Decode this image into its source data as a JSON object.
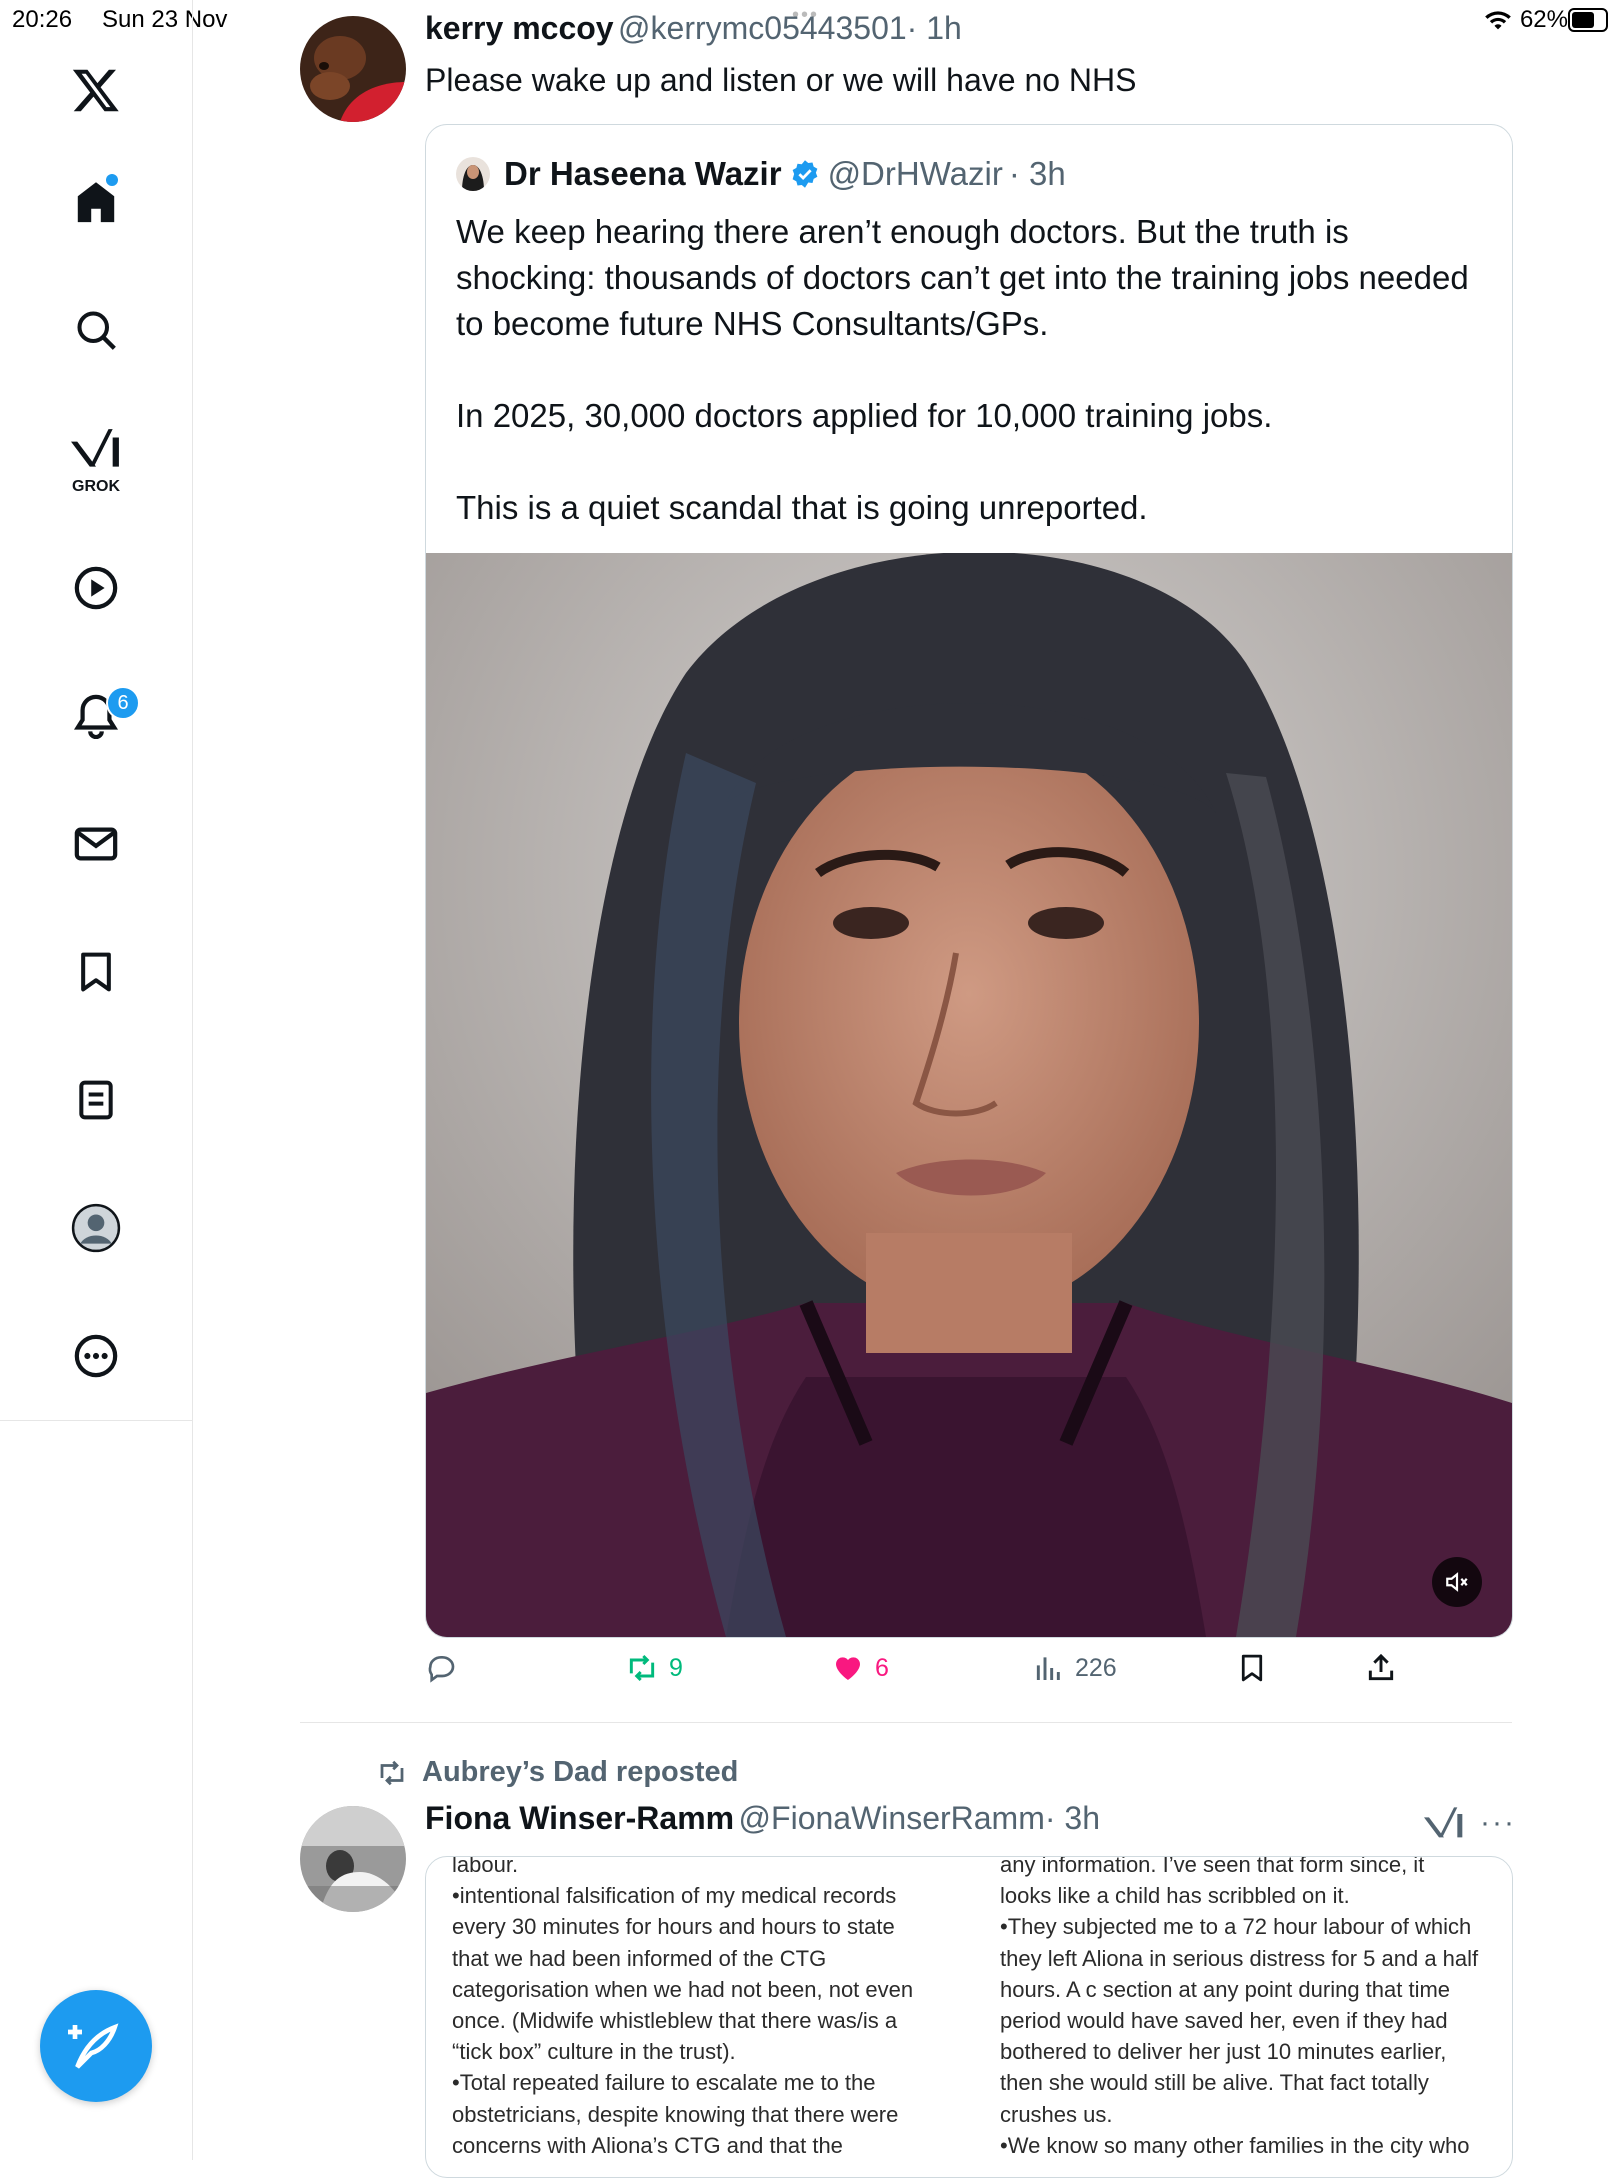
{
  "status_bar": {
    "time": "20:26",
    "date": "Sun 23 Nov",
    "battery": "62%"
  },
  "sidebar": {
    "grok_label": "GROK",
    "notifications_badge": "6",
    "items": [
      "x-logo",
      "home",
      "search",
      "grok",
      "video",
      "notifications",
      "messages",
      "bookmarks",
      "lists",
      "profile",
      "more"
    ]
  },
  "tweet": {
    "author_name": "kerry mccoy",
    "author_handle": "@kerrymc05443501",
    "time": "· 1h",
    "text": "Please wake up and listen or we will have no NHS",
    "quote": {
      "author_name": "Dr Haseena Wazir",
      "author_handle": "@DrHWazir",
      "time": "· 3h",
      "text": "We keep hearing there aren’t enough doctors. But the truth is shocking: thousands of doctors can’t get into the training jobs needed to become future NHS Consultants/GPs.\n\nIn 2025, 30,000 doctors applied for 10,000 training jobs.\n\nThis is a quiet scandal that is going unreported."
    },
    "actions": {
      "replies": "",
      "reposts": "9",
      "likes": "6",
      "views": "226"
    },
    "colors": {
      "repost": "#00ba7c",
      "like": "#f91880"
    }
  },
  "next_tweet": {
    "repost_label": "Aubrey’s Dad reposted",
    "author_name": "Fiona Winser-Ramm",
    "author_handle": "@FionaWinserRamm",
    "time": "· 3h",
    "doc_left": "labour.\n•intentional falsification of my medical records\nevery 30 minutes for hours and hours to state\nthat we had been informed of the CTG\ncategorisation when we had not been, not even\nonce. (Midwife whistleblew that there was/is a\n“tick box” culture in the trust).\n•Total repeated failure to escalate me to the\nobstetricians, despite knowing that there were\nconcerns with Aliona’s CTG and that the",
    "doc_right": "any information. I’ve seen that form since, it\nlooks like a child has scribbled on it.\n•They subjected me to a 72 hour labour of which\nthey left Aliona in serious distress for 5 and a half\nhours. A c section at any point during that time\nperiod would have saved her, even if they had\nbothered to deliver her just 10 minutes earlier,\nthen she would still be alive. That fact totally\ncrushes us.\n•We know so many other families in the city who"
  },
  "accent_color": "#1d9bf0"
}
